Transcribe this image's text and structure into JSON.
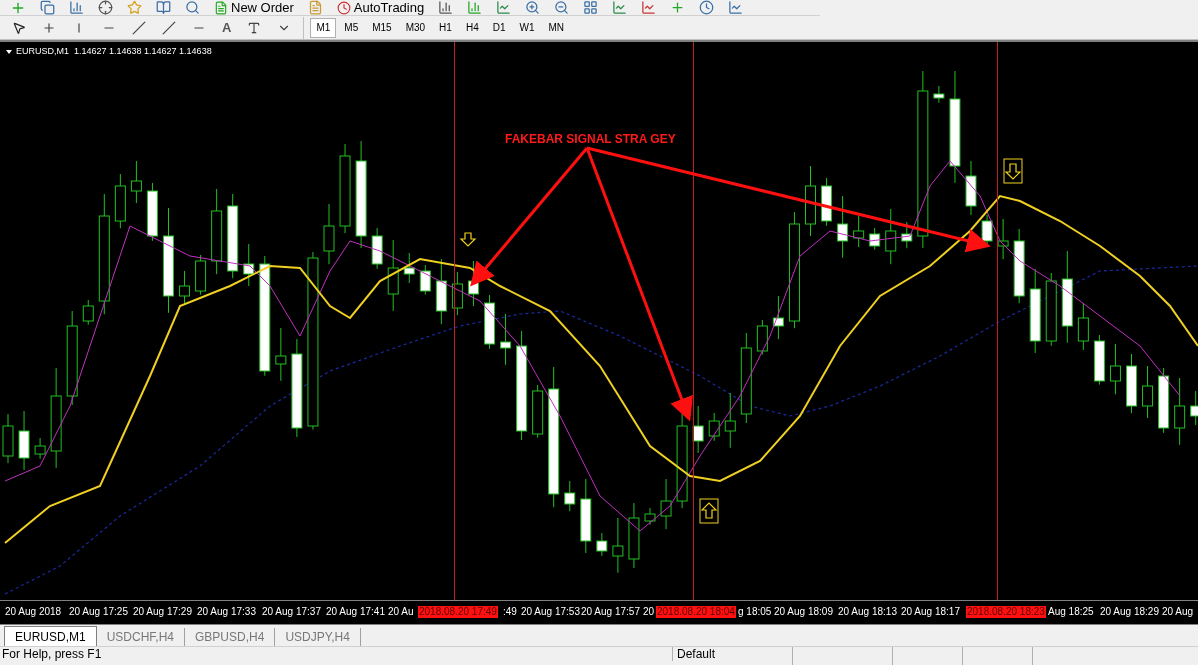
{
  "toolbar": {
    "new_order": "New Order",
    "auto_trading": "AutoTrading",
    "text_tool": "A",
    "timeframes": [
      {
        "label": "M1",
        "selected": true
      },
      {
        "label": "M5",
        "selected": false
      },
      {
        "label": "M15",
        "selected": false
      },
      {
        "label": "M30",
        "selected": false
      },
      {
        "label": "H1",
        "selected": false
      },
      {
        "label": "H4",
        "selected": false
      },
      {
        "label": "D1",
        "selected": false
      },
      {
        "label": "W1",
        "selected": false
      },
      {
        "label": "MN",
        "selected": false
      }
    ]
  },
  "chart": {
    "header": "EURUSD,M1  1.14627 1.14638 1.14627 1.14638",
    "annotation": "FAKEBAR SIGNAL STRA GEY",
    "time_axis": [
      {
        "kind": "tick",
        "text": "20 Aug 2018"
      },
      {
        "kind": "tick",
        "text": "20 Aug 17:25"
      },
      {
        "kind": "tick",
        "text": "20 Aug 17:29"
      },
      {
        "kind": "tick",
        "text": "20 Aug 17:33"
      },
      {
        "kind": "tick",
        "text": "20 Aug 17:37"
      },
      {
        "kind": "tick",
        "text": "20 Aug 17:41"
      },
      {
        "kind": "tick",
        "text": "20 Au"
      },
      {
        "kind": "marker",
        "text": "2018.08.20 17:49"
      },
      {
        "kind": "tick",
        "text": ":49"
      },
      {
        "kind": "tick",
        "text": "20 Aug 17:53"
      },
      {
        "kind": "tick",
        "text": "20 Aug 17:57"
      },
      {
        "kind": "tick",
        "text": "20"
      },
      {
        "kind": "marker",
        "text": "2018.08.20 18:04"
      },
      {
        "kind": "tick",
        "text": "g 18:05"
      },
      {
        "kind": "tick",
        "text": "20 Aug 18:09"
      },
      {
        "kind": "tick",
        "text": "20 Aug 18:13"
      },
      {
        "kind": "tick",
        "text": "20 Aug 18:17"
      },
      {
        "kind": "marker",
        "text": "2018.08.20 18:23"
      },
      {
        "kind": "tick",
        "text": "Aug 18:25"
      },
      {
        "kind": "tick",
        "text": "20 Aug 18:29"
      },
      {
        "kind": "tick",
        "text": "20 Aug"
      }
    ]
  },
  "tabs": [
    {
      "label": "EURUSD,M1",
      "selected": true
    },
    {
      "label": "USDCHF,H4",
      "selected": false
    },
    {
      "label": "GBPUSD,H4",
      "selected": false
    },
    {
      "label": "USDJPY,H4",
      "selected": false
    }
  ],
  "status_bar": {
    "help": "For Help, press F1",
    "profile": "Default"
  }
}
